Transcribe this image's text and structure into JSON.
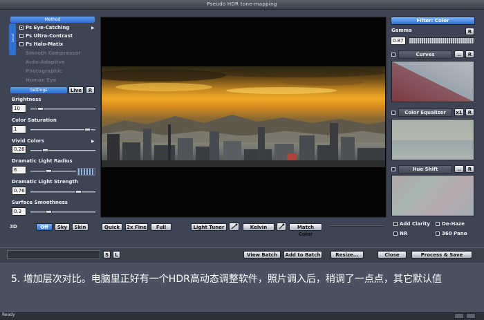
{
  "window": {
    "title": "Pseudo HDR tone-mapping"
  },
  "left": {
    "method_header": "Method",
    "vertical_tab": "Local",
    "methods": [
      {
        "label": "Ps Eye-Catching",
        "checked": true,
        "enabled": true
      },
      {
        "label": "Ps Ultra-Contrast",
        "checked": false,
        "enabled": true
      },
      {
        "label": "Ps Halo-Matix",
        "checked": false,
        "enabled": true
      },
      {
        "label": "Smooth Compressor",
        "enabled": false
      },
      {
        "label": "Auto-Adaptive",
        "enabled": false
      },
      {
        "label": "Photographic",
        "enabled": false
      },
      {
        "label": "Human Eye",
        "enabled": false
      }
    ],
    "settings_header": "Settings",
    "live_label": "Live",
    "r_label": "R",
    "sliders": [
      {
        "label": "Brightness",
        "value": "10",
        "pos": 0.12
      },
      {
        "label": "Color Saturation",
        "value": "1",
        "pos": 0.92
      },
      {
        "label": "Vivid Colors",
        "value": "0.26",
        "pos": 0.2
      },
      {
        "label": "Dramatic Light Radius",
        "value": "6",
        "pos": 0.38
      },
      {
        "label": "Dramatic Light Strength",
        "value": "0.76",
        "pos": 0.76
      },
      {
        "label": "Surface Smoothness",
        "value": "0.3",
        "pos": 0.26
      }
    ],
    "mode_label": "3D",
    "modes": [
      "Off",
      "Sky",
      "Skin"
    ]
  },
  "center": {
    "buttons": {
      "quick": "Quick",
      "fine": "2x Fine",
      "full": "Full",
      "light_tuner": "Light Tuner",
      "kelvin": "Kelvin",
      "match_color": "Match Color"
    }
  },
  "right": {
    "filter_header": "Filter: Color",
    "gamma_label": "Gamma",
    "gamma_value": "0.87",
    "r_label": "R",
    "dots_label": "..",
    "x1_label": "x1",
    "curves_label": "Curves",
    "equalizer_label": "Color Equalizer",
    "hue_label": "Hue Shift",
    "options": {
      "add_clarity": "Add Clarity",
      "de_haze": "De-Haze",
      "nr": "NR",
      "pano": "360 Pano"
    }
  },
  "bottom": {
    "s_label": "S",
    "l_label": "L",
    "view_batch": "View Batch",
    "add_to_batch": "Add to Batch",
    "resize": "Resize...",
    "close": "Close",
    "process_save": "Process & Save"
  },
  "caption": "5. 增加层次对比。电脑里正好有一个HDR高动态调整软件，照片调入后，稍调了一点点，其它默认值",
  "status": {
    "text": "Ready"
  }
}
